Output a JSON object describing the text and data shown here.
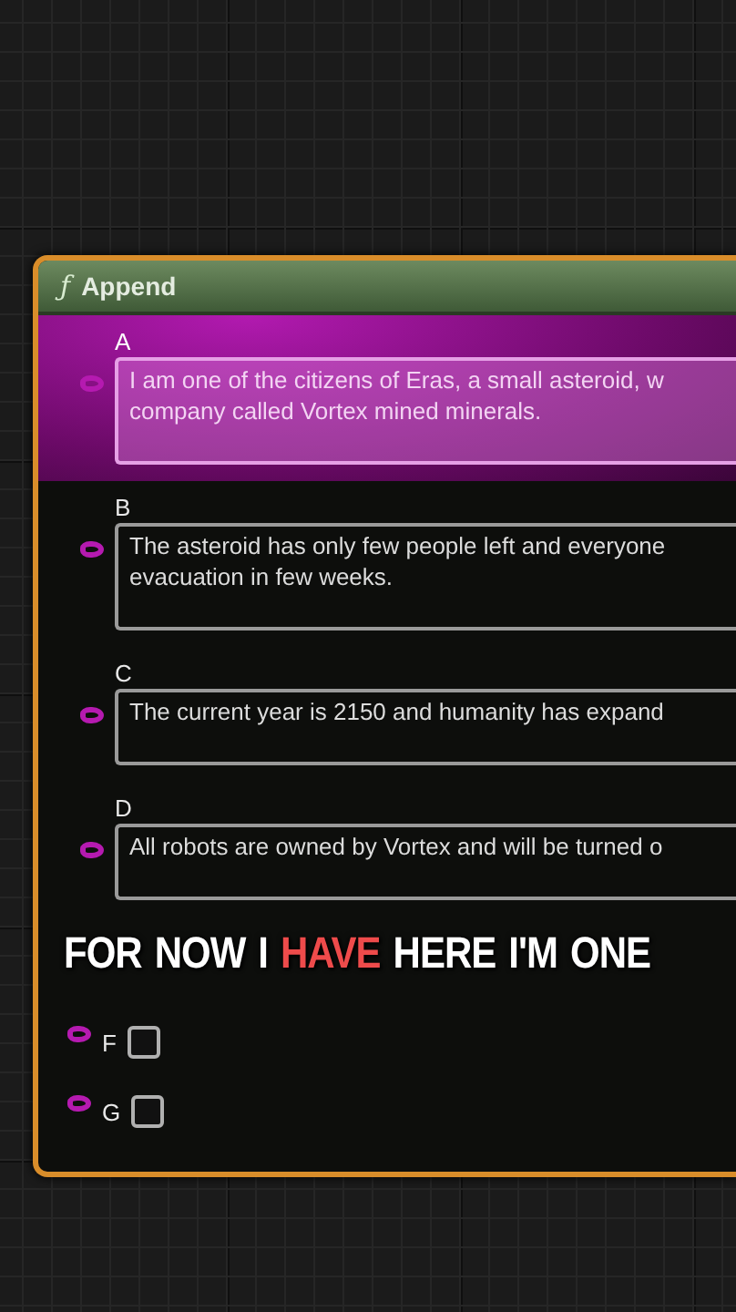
{
  "node": {
    "icon": "ƒ",
    "title": "Append",
    "pins": [
      {
        "kind": "text",
        "label": "A",
        "selected": true,
        "lines": [
          "I am one of the citizens of Eras, a small asteroid, w",
          "company called Vortex mined minerals."
        ]
      },
      {
        "kind": "text",
        "label": "B",
        "selected": false,
        "lines": [
          "The asteroid has only few people left and everyone",
          "evacuation in few weeks."
        ]
      },
      {
        "kind": "text",
        "label": "C",
        "selected": false,
        "lines": [
          "The current year is 2150 and humanity has expand"
        ]
      },
      {
        "kind": "text",
        "label": "D",
        "selected": false,
        "lines": [
          "All robots are owned by Vortex and will be turned o"
        ]
      },
      {
        "kind": "checkbox",
        "label": "F",
        "selected": false,
        "checked": false
      },
      {
        "kind": "checkbox",
        "label": "G",
        "selected": false,
        "checked": false
      }
    ]
  },
  "caption": {
    "words": [
      {
        "text": "FOR",
        "highlighted": false
      },
      {
        "text": "NOW",
        "highlighted": false
      },
      {
        "text": "I",
        "highlighted": false
      },
      {
        "text": "HAVE",
        "highlighted": true
      },
      {
        "text": "HERE",
        "highlighted": false
      },
      {
        "text": "I'M",
        "highlighted": false
      },
      {
        "text": "ONE",
        "highlighted": false
      }
    ]
  }
}
